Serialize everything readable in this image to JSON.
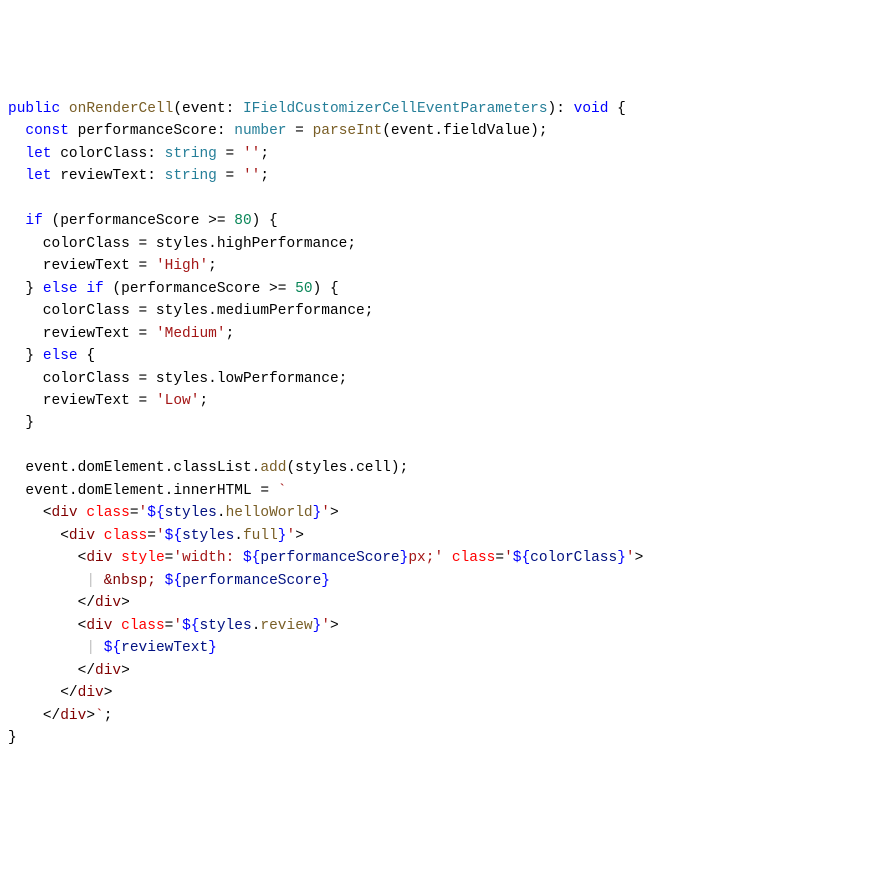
{
  "code": {
    "line1": {
      "kw_public": "public",
      "fn_onRenderCell": "onRenderCell",
      "paren_o": "(",
      "param_event": "event",
      "colon1": ": ",
      "type_IFieldCustomizerCellEventParameters": "IFieldCustomizerCellEventParameters",
      "paren_c": ")",
      "colon2": ": ",
      "kw_void": "void",
      "brace_o": " {"
    },
    "line2": {
      "kw_const": "const",
      "var_performanceScore": " performanceScore",
      "colon": ": ",
      "type_number": "number",
      "eq": " = ",
      "fn_parseInt": "parseInt",
      "rest": "(event.fieldValue);"
    },
    "line3": {
      "kw_let": "let",
      "var_colorClass": " colorClass",
      "colon": ": ",
      "type_string": "string",
      "eq": " = ",
      "str_empty": "''",
      "semi": ";"
    },
    "line4": {
      "kw_let": "let",
      "var_reviewText": " reviewText",
      "colon": ": ",
      "type_string": "string",
      "eq": " = ",
      "str_empty": "''",
      "semi": ";"
    },
    "line6": {
      "kw_if": "if",
      "pre": " (performanceScore >= ",
      "num_80": "80",
      "post": ") {"
    },
    "line7_a": "    colorClass = styles.highPerformance;",
    "line8": {
      "pre": "    reviewText = ",
      "str": "'High'",
      "semi": ";"
    },
    "line9": {
      "close": "  } ",
      "kw_else": "else",
      "sp": " ",
      "kw_if": "if",
      "pre": " (performanceScore >= ",
      "num_50": "50",
      "post": ") {"
    },
    "line10_a": "    colorClass = styles.mediumPerformance;",
    "line11": {
      "pre": "    reviewText = ",
      "str": "'Medium'",
      "semi": ";"
    },
    "line12": {
      "close": "  } ",
      "kw_else": "else",
      "post": " {"
    },
    "line13_a": "    colorClass = styles.lowPerformance;",
    "line14": {
      "pre": "    reviewText = ",
      "str": "'Low'",
      "semi": ";"
    },
    "line15": "  }",
    "line17": "  event.domElement.classList.",
    "line17_add": "add",
    "line17_rest": "(styles.cell);",
    "line18_a": "  event.domElement.innerHTML = ",
    "line18_tick": "`",
    "line19": {
      "pad": "    ",
      "lt": "<",
      "tag": "div",
      "sp": " ",
      "attr": "class",
      "eq": "=",
      "q1": "'",
      "do": "${",
      "val": "styles",
      "dot": ".",
      "val2": "helloWorld",
      "dc": "}",
      "q2": "'",
      "gt": ">"
    },
    "line20": {
      "pad": "      ",
      "lt": "<",
      "tag": "div",
      "sp": " ",
      "attr": "class",
      "eq": "=",
      "q1": "'",
      "do": "${",
      "val": "styles",
      "dot": ".",
      "val2": "full",
      "dc": "}",
      "q2": "'",
      "gt": ">"
    },
    "line21": {
      "pad": "        ",
      "lt": "<",
      "tag": "div",
      "sp": " ",
      "attr_style": "style",
      "eq": "=",
      "q1": "'",
      "txt_width": "width: ",
      "do1": "${",
      "v1": "performanceScore",
      "dc1": "}",
      "txt_px": "px;",
      "q2": "'",
      "sp2": " ",
      "attr_class": "class",
      "eq2": "=",
      "q3": "'",
      "do2": "${",
      "v2": "colorClass",
      "dc2": "}",
      "q4": "'",
      "gt": ">"
    },
    "line22": {
      "pad": "         ",
      "pipe": "|",
      "sp": " ",
      "nbsp": "&nbsp;",
      "sp2": " ",
      "do": "${",
      "v": "performanceScore",
      "dc": "}"
    },
    "line23": {
      "pad": "        ",
      "lt": "</",
      "tag": "div",
      "gt": ">"
    },
    "line24": {
      "pad": "        ",
      "lt": "<",
      "tag": "div",
      "sp": " ",
      "attr": "class",
      "eq": "=",
      "q1": "'",
      "do": "${",
      "val": "styles",
      "dot": ".",
      "val2": "review",
      "dc": "}",
      "q2": "'",
      "gt": ">"
    },
    "line25": {
      "pad": "         ",
      "pipe": "|",
      "sp": " ",
      "do": "${",
      "v": "reviewText",
      "dc": "}"
    },
    "line26": {
      "pad": "        ",
      "lt": "</",
      "tag": "div",
      "gt": ">"
    },
    "line27": {
      "pad": "      ",
      "lt": "</",
      "tag": "div",
      "gt": ">"
    },
    "line28": {
      "pad": "    ",
      "lt": "</",
      "tag": "div",
      "gt": ">",
      "tick": "`",
      "semi": ";"
    },
    "line29": "}"
  }
}
